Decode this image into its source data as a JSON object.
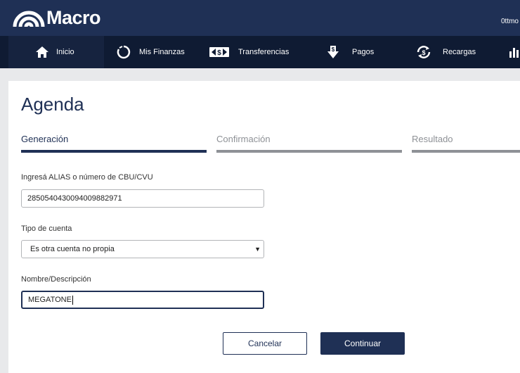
{
  "header": {
    "brand": "Macro",
    "user_text": "0ttmo"
  },
  "nav": {
    "items": [
      {
        "label": "Inicio",
        "icon": "home-icon"
      },
      {
        "label": "Mis Finanzas",
        "icon": "circle-chart-icon"
      },
      {
        "label": "Transferencias",
        "icon": "transfer-icon"
      },
      {
        "label": "Pagos",
        "icon": "payment-icon"
      },
      {
        "label": "Recargas",
        "icon": "recharge-icon"
      },
      {
        "label": "",
        "icon": "bar-chart-icon"
      }
    ]
  },
  "page": {
    "title": "Agenda"
  },
  "steps": [
    {
      "label": "Generación",
      "state": "active"
    },
    {
      "label": "Confirmación",
      "state": "inactive"
    },
    {
      "label": "Resultado",
      "state": "inactive"
    }
  ],
  "form": {
    "cbu_label": "Ingresá ALIAS o número de CBU/CVU",
    "cbu_value": "2850540430094009882971",
    "account_type_label": "Tipo de cuenta",
    "account_type_value": "Es otra cuenta no propia",
    "description_label": "Nombre/Descripción",
    "description_value": "MEGATONE"
  },
  "buttons": {
    "cancel": "Cancelar",
    "continue": "Continuar"
  },
  "colors": {
    "brand_navy": "#1f3055",
    "nav_dark": "#0f1b33",
    "inactive_step": "#8e9196"
  }
}
